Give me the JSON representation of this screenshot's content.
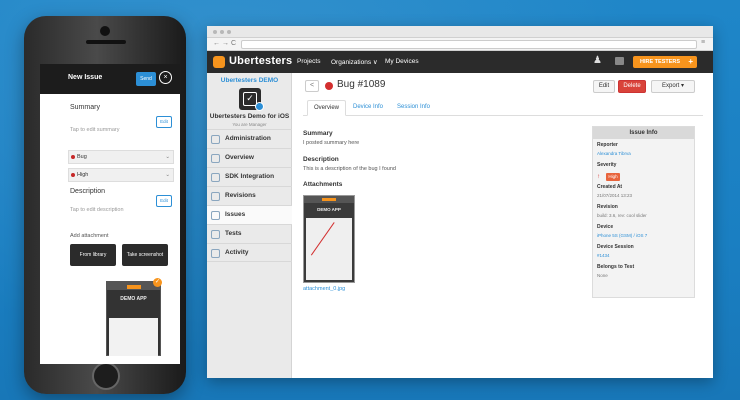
{
  "phone": {
    "title": "New Issue",
    "send_label": "Send",
    "close_glyph": "×",
    "summary_label": "Summary",
    "summary_placeholder": "Tap to edit summary",
    "edit_label": "Edit",
    "type_value": "Bug",
    "severity_value": "High",
    "description_label": "Description",
    "description_placeholder": "Tap to edit description",
    "attachment_label": "Add attachment",
    "from_library_label": "From library",
    "screenshot_label": "Take screenshot",
    "thumb_title": "DEMO APP",
    "thumb_check": "✓"
  },
  "topbar": {
    "brand": "Ubertesters",
    "nav": [
      "Projects",
      "Organizations ∨",
      "My Devices"
    ],
    "hire_label": "HIRE TESTERS",
    "hire_plus": "+",
    "user_glyph": "♟"
  },
  "sidebar": {
    "project": "Ubertesters DEMO",
    "app_name": "Ubertesters Demo for iOS",
    "role": "You are Manager",
    "items": [
      "Administration",
      "Overview",
      "SDK Integration",
      "Revisions",
      "Issues",
      "Tests",
      "Activity"
    ]
  },
  "issue": {
    "back_glyph": "<",
    "title": "Bug #1089",
    "edit_label": "Edit",
    "delete_label": "Delete",
    "export_label": "Export ▾",
    "tabs": [
      "Overview",
      "Device Info",
      "Session Info"
    ],
    "summary_heading": "Summary",
    "summary_text": "I posted summary here",
    "description_heading": "Description",
    "description_text": "This is a description of the bug I found",
    "attachments_heading": "Attachments",
    "attachment_title": "DEMO APP",
    "attachment_name": "attachment_0.jpg"
  },
  "info": {
    "heading": "Issue Info",
    "reporter_label": "Reporter",
    "reporter_value": "Alexandra Tibrva",
    "severity_label": "Severity",
    "severity_value": "High",
    "created_label": "Created At",
    "created_value": "21/07/2014 13:23",
    "revision_label": "Revision",
    "revision_value": "build: 3.6, rev: cool slider",
    "device_label": "Device",
    "device_value": "iPhone 5S (GSM) / iOS 7",
    "session_label": "Device Session",
    "session_value": "#1434",
    "belongs_label": "Belongs to Test",
    "belongs_value": "None"
  },
  "colors": {
    "background": "#1c82c4",
    "accent": "#f7941d",
    "link": "#2c8fd6",
    "delete": "#d9433a",
    "topbar": "#2b2b2b"
  }
}
